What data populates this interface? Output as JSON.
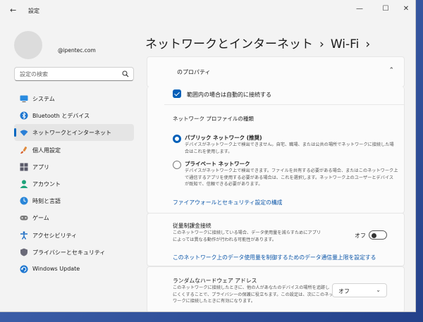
{
  "window": {
    "app_title": "設定",
    "back_icon": "arrow-left-icon",
    "controls": {
      "minimize": "—",
      "maximize": "☐",
      "close": "✕"
    }
  },
  "account": {
    "email": "@ipentec.com"
  },
  "search": {
    "placeholder": "設定の検索",
    "icon": "search-icon"
  },
  "sidebar": {
    "items": [
      {
        "label": "システム",
        "icon": "monitor-icon",
        "active": false
      },
      {
        "label": "Bluetooth とデバイス",
        "icon": "bluetooth-icon",
        "active": false
      },
      {
        "label": "ネットワークとインターネット",
        "icon": "wifi-icon",
        "active": true
      },
      {
        "label": "個人用設定",
        "icon": "brush-icon",
        "active": false
      },
      {
        "label": "アプリ",
        "icon": "apps-icon",
        "active": false
      },
      {
        "label": "アカウント",
        "icon": "person-icon",
        "active": false
      },
      {
        "label": "時刻と言語",
        "icon": "clock-globe-icon",
        "active": false
      },
      {
        "label": "ゲーム",
        "icon": "gamepad-icon",
        "active": false
      },
      {
        "label": "アクセシビリティ",
        "icon": "accessibility-icon",
        "active": false
      },
      {
        "label": "プライバシーとセキュリティ",
        "icon": "shield-icon",
        "active": false
      },
      {
        "label": "Windows Update",
        "icon": "update-icon",
        "active": false
      }
    ],
    "accent": "#0067c0"
  },
  "breadcrumb": {
    "parent": "ネットワークとインターネット",
    "separator": "›",
    "current": "Wi-Fi",
    "trailing": "›"
  },
  "properties": {
    "header": "のプロパティ",
    "auto_connect": {
      "label": "範囲内の場合は自動的に接続する",
      "checked": true
    },
    "profile_type_title": "ネットワーク プロファイルの種類",
    "public": {
      "title": "パブリック ネットワーク (推奨)",
      "desc_line1": "デバイスがネットワーク上で検出できません。自宅、職場、または公共の場所でネットワークに接続した場",
      "desc_line2": "合はこれを使用します。",
      "selected": true
    },
    "private": {
      "title": "プライベート ネットワーク",
      "desc_line1": "デバイスがネットワーク上で検出できます。ファイルを共有する必要がある場合、またはこのネットワーク上",
      "desc_line2": "で通信するアプリを使用する必要がある場合は、これを選択します。ネットワーク上のユーザーとデバイス",
      "desc_line3": "が既知で、信頼できる必要があります。",
      "selected": false
    },
    "firewall_link": "ファイアウォールとセキュリティ設定の構成"
  },
  "metered": {
    "title": "従量制課金接続",
    "desc_line1": "このネットワークに接続している場合、データ使用量を減らすためにアプリ",
    "desc_line2": "によっては異なる動作が行われる可能性があります。",
    "toggle_label": "オフ",
    "toggle_on": false,
    "data_limit_link": "このネットワーク上のデータ使用量を制御するためのデータ通信量上限を設定する"
  },
  "random_hw": {
    "title": "ランダムなハードウェア アドレス",
    "desc_line1": "このネットワークに接続したときに、他の人があなたのデバイスの場所を追跡し",
    "desc_line2": "にくくすることで、プライバシーの保護に役立ちます。この設定は、次にこのネット",
    "desc_line3": "ワークに接続したときに有効になります。",
    "select_value": "オフ",
    "select_icon": "chevron-down-icon"
  }
}
